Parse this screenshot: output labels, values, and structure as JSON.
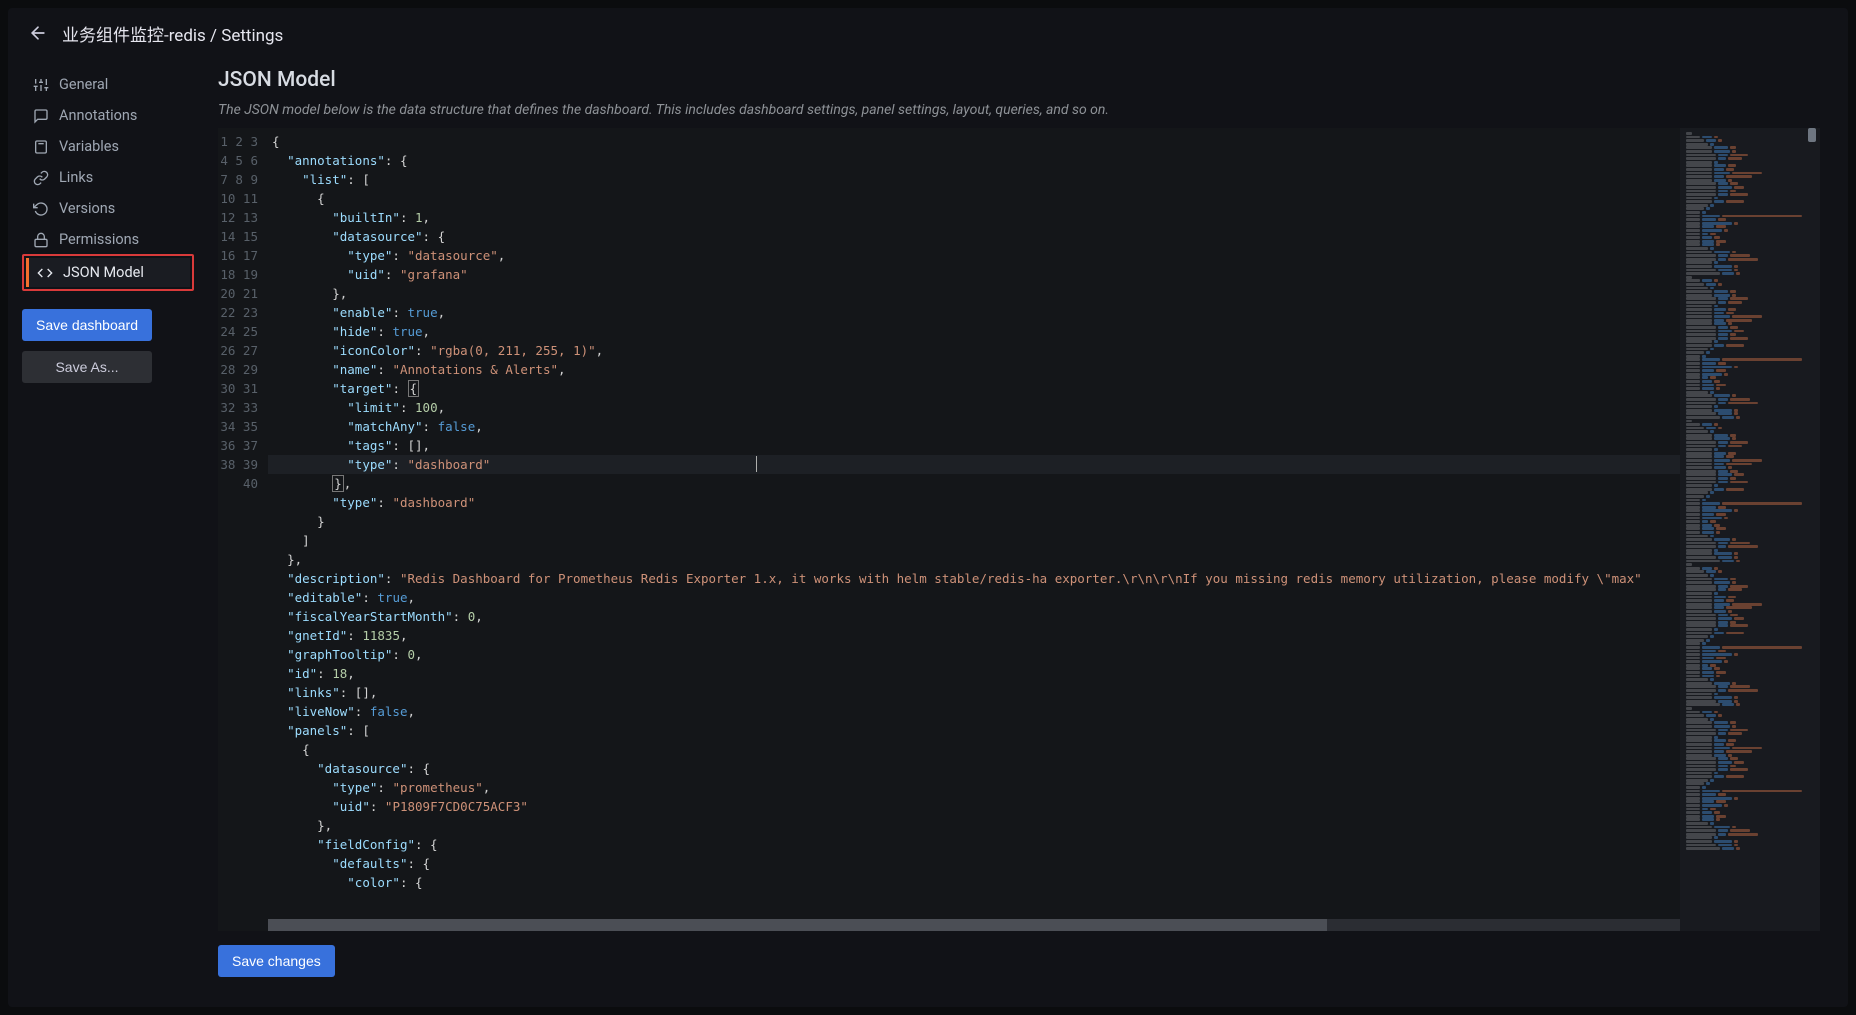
{
  "header": {
    "title": "业务组件监控-redis / Settings"
  },
  "sidebar": {
    "items": [
      {
        "label": "General"
      },
      {
        "label": "Annotations"
      },
      {
        "label": "Variables"
      },
      {
        "label": "Links"
      },
      {
        "label": "Versions"
      },
      {
        "label": "Permissions"
      },
      {
        "label": "JSON Model"
      }
    ],
    "save_dashboard": "Save dashboard",
    "save_as": "Save As..."
  },
  "main": {
    "title": "JSON Model",
    "subtitle": "The JSON model below is the data structure that defines the dashboard. This includes dashboard settings, panel settings, layout, queries, and so on.",
    "save_changes": "Save changes",
    "line_start": 1,
    "line_end": 40,
    "json_model": {
      "annotations": {
        "list": [
          {
            "builtIn": 1,
            "datasource": {
              "type": "datasource",
              "uid": "grafana"
            },
            "enable": true,
            "hide": true,
            "iconColor": "rgba(0, 211, 255, 1)",
            "name": "Annotations & Alerts",
            "target": {
              "limit": 100,
              "matchAny": false,
              "tags": [],
              "type": "dashboard"
            },
            "type": "dashboard"
          }
        ]
      },
      "description": "Redis Dashboard for Prometheus Redis Exporter 1.x, it works with helm stable/redis-ha exporter.\\r\\n\\r\\nIf you missing redis memory utilization, please modify \\\"max",
      "editable": true,
      "fiscalYearStartMonth": 0,
      "gnetId": 11835,
      "graphTooltip": 0,
      "id": 18,
      "links": [],
      "liveNow": false,
      "panels": [
        {
          "datasource": {
            "type": "prometheus",
            "uid": "P1809F7CD0C75ACF3"
          },
          "fieldConfig": {
            "defaults": {
              "color": {}
            }
          }
        }
      ]
    }
  }
}
